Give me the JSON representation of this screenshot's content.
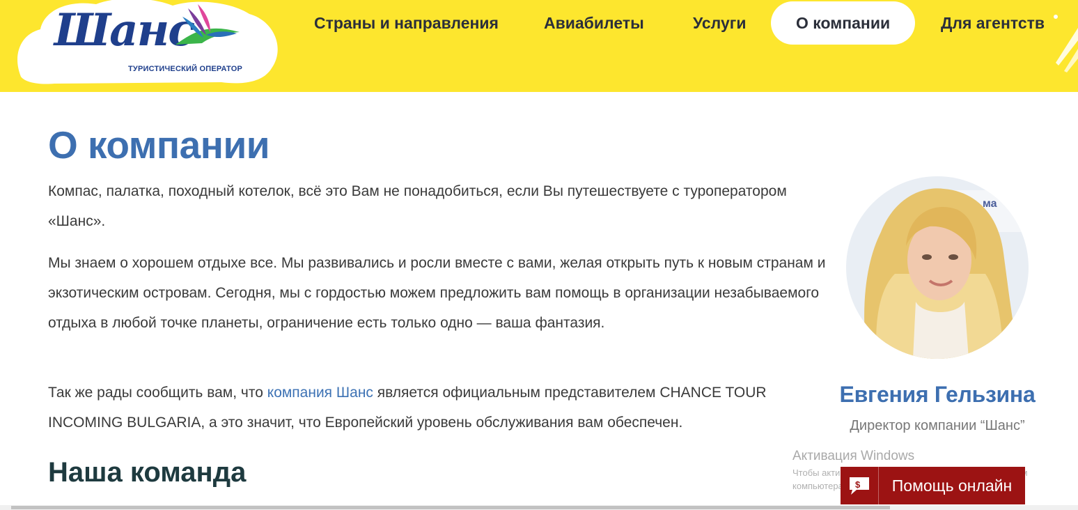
{
  "brand": {
    "logo_text": "Шанс",
    "tagline": "ТУРИСТИЧЕСКИЙ ОПЕРАТОР",
    "header_color": "#fde62e",
    "accent_color": "#3d6fb0",
    "help_color": "#9c1313"
  },
  "nav": {
    "items": [
      {
        "label": "Страны и направления",
        "active": false
      },
      {
        "label": "Авиабилеты",
        "active": false
      },
      {
        "label": "Услуги",
        "active": false
      },
      {
        "label": "О компании",
        "active": true
      },
      {
        "label": "Для агентств",
        "active": false
      }
    ]
  },
  "main": {
    "title": "О компании",
    "paragraph1": "Компас, палатка, походный котелок, всё это Вам не понадобиться, если Вы путешествуете с туроператором «Шанс».",
    "paragraph2": "Мы знаем о хорошем отдыхе все. Мы развивались и росли вместе с вами, желая открыть путь к новым странам и экзотическим островам. Сегодня, мы с гордостью можем предложить вам помощь в организации незабываемого отдыха в любой точке планеты, ограничение есть только одно — ваша фантазия.",
    "paragraph3_before": "Так же рады сообщить вам, что ",
    "paragraph3_link": "компания Шанс",
    "paragraph3_after": " является официальным представителем CHANCE TOUR INCOMING BULGARIA, а это значит, что Европейский уровень обслуживания вам обеспечен.",
    "team_title": "Наша команда"
  },
  "director": {
    "name": "Евгения Гельзина",
    "role": "Директор компании “Шанс”",
    "photo_icon": "portrait-photo"
  },
  "watermark": {
    "title": "Активация Windows",
    "subtitle": "Чтобы активировать Windows, перейдите к параметрам компьютера."
  },
  "help_widget": {
    "label": "Помощь онлайн",
    "icon": "chat-bubble-icon"
  }
}
